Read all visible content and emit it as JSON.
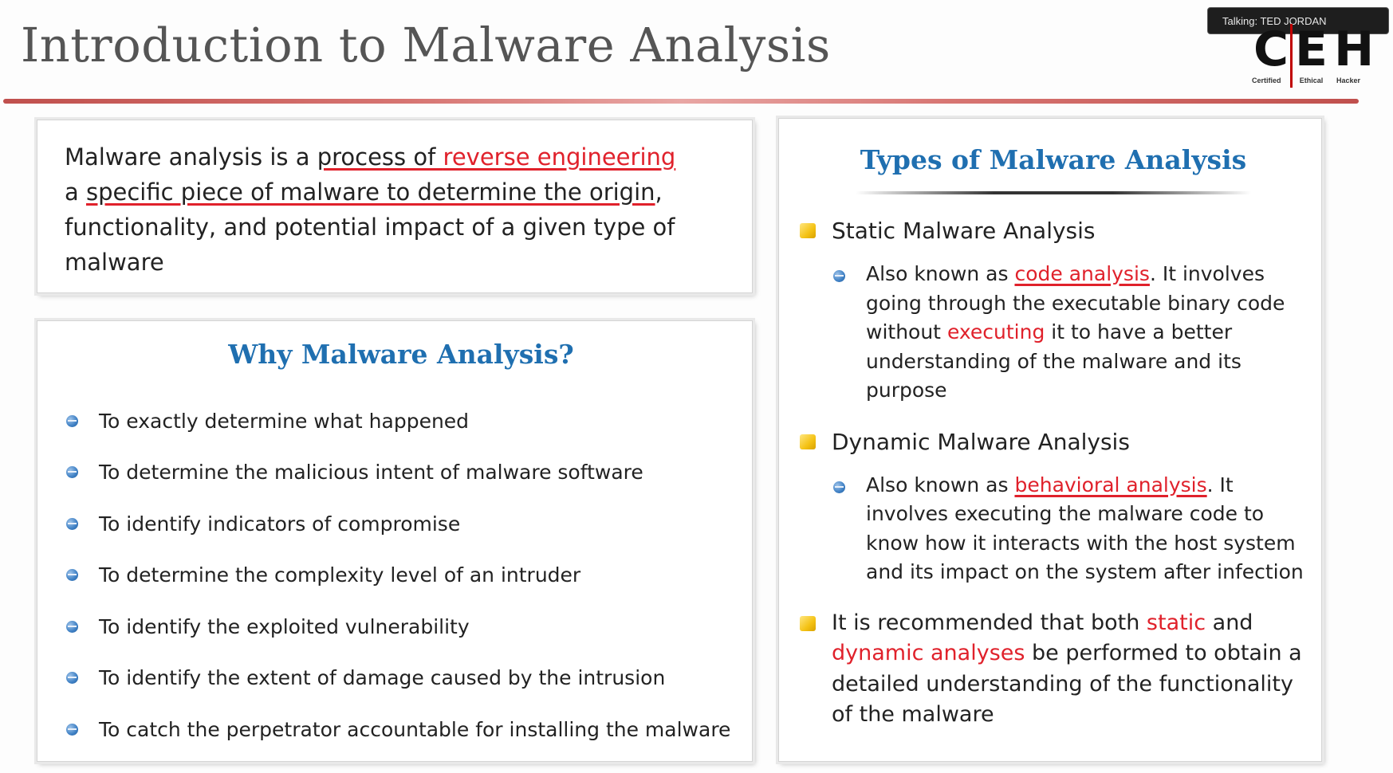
{
  "slide": {
    "title": "Introduction to Malware Analysis"
  },
  "talking_badge": "Talking: TED JORDAN",
  "logo": {
    "letters": [
      "C",
      "E",
      "H"
    ],
    "sub": [
      "Certified",
      "Ethical",
      "Hacker"
    ]
  },
  "definition": {
    "part1": "Malware analysis is a ",
    "part2": "process of ",
    "part3": "reverse engineering",
    "part4": "a ",
    "part5": "specific piece of malware to determine the origin",
    "part6": ", functionality, and potential impact of a given type of malware"
  },
  "why": {
    "heading": "Why Malware Analysis?",
    "items": [
      "To exactly determine what happened",
      "To determine the malicious intent of malware software",
      "To identify indicators of compromise",
      "To determine the complexity level of an intruder",
      "To identify the exploited vulnerability",
      "To identify the extent of damage caused by the intrusion",
      "To catch the perpetrator accountable for installing the malware"
    ]
  },
  "types": {
    "heading": "Types of Malware Analysis",
    "static": {
      "label": "Static Malware Analysis",
      "t1": "Also known as ",
      "t2": "code analysis",
      "t3": ". It involves going through the executable binary code without ",
      "t4": "executing",
      "t5": " it to have a better understanding of the malware and its purpose"
    },
    "dynamic": {
      "label": "Dynamic Malware Analysis",
      "t1": "Also known as ",
      "t2": "behavioral analysis",
      "t3": ". It involves executing the malware code to know how it interacts with the host system and its impact on the system after infection"
    },
    "recommend": {
      "t1": "It is recommended that both ",
      "t2": "static",
      "t3": " and ",
      "t4": "dynamic analyses",
      "t5": " be performed to obtain a detailed understanding of the functionality of the malware"
    }
  },
  "colors": {
    "accent_red": "#e0212b",
    "heading_blue": "#1f6fb0",
    "bullet_yellow": "#f4c214",
    "title_rule": "#c0504d"
  }
}
